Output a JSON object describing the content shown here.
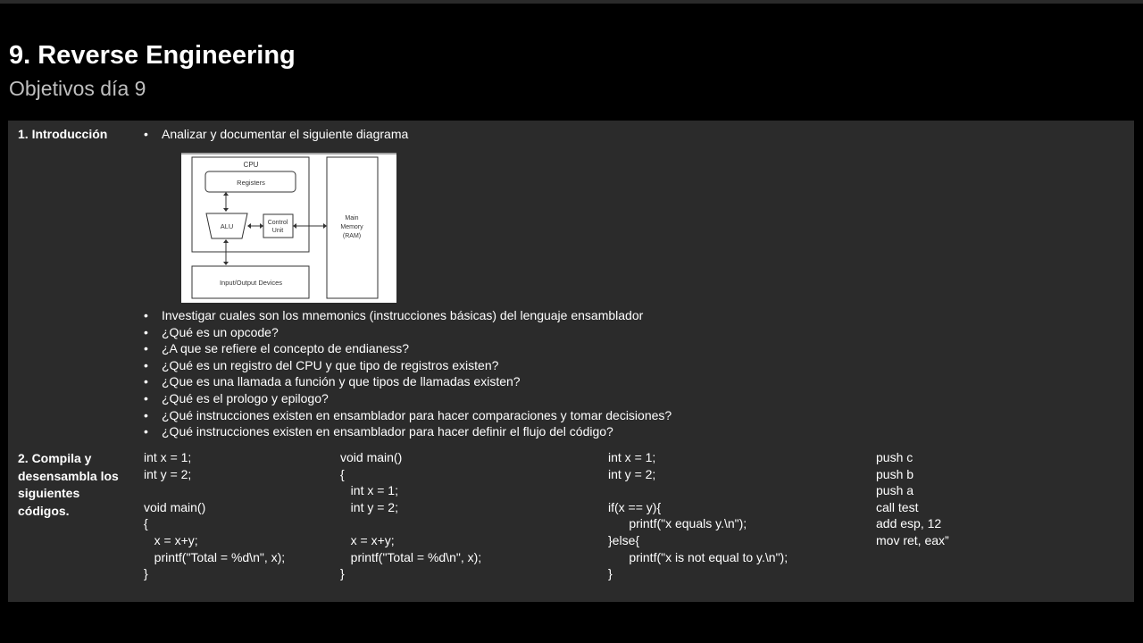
{
  "slide": {
    "title": "9. Reverse Engineering",
    "subtitle": "Objetivos día 9"
  },
  "section1": {
    "label": "1. Introducción",
    "intro_bullet": "Analizar y documentar el siguiente diagrama",
    "diagram": {
      "cpu": "CPU",
      "registers": "Registers",
      "alu": "ALU",
      "control_unit_line1": "Control",
      "control_unit_line2": "Unit",
      "memory_line1": "Main",
      "memory_line2": "Memory",
      "memory_line3": "(RAM)",
      "io": "Input/Output Devices"
    },
    "bullets": [
      "Investigar cuales son los mnemonics (instrucciones básicas) del lenguaje ensamblador",
      "¿Qué es un opcode?",
      "¿A que se refiere el concepto de endianess?",
      "¿Qué es un registro del CPU y que tipo de registros existen?",
      "¿Que es una llamada a función y que tipos de llamadas existen?",
      "¿Qué es el prologo y epilogo?",
      "¿Qué instrucciones existen en ensamblador para hacer comparaciones y tomar decisiones?",
      "¿Qué instrucciones existen en ensamblador para hacer definir el flujo del código?"
    ]
  },
  "section2": {
    "label": "2. Compila y desensambla los siguientes códigos.",
    "code1": "int x = 1;\nint y = 2;\n\nvoid main()\n{\n   x = x+y;\n   printf(\"Total = %d\\n\", x);\n}",
    "code2": "void main()\n{\n   int x = 1;\n   int y = 2;\n\n   x = x+y;\n   printf(\"Total = %d\\n\", x);\n}",
    "code3": "int x = 1;\nint y = 2;\n\nif(x == y){\n      printf(\"x equals y.\\n\");\n}else{\n      printf(\"x is not equal to y.\\n\");\n}",
    "code4": "push c\npush b\npush a\ncall test\nadd esp, 12\nmov ret, eax”"
  }
}
